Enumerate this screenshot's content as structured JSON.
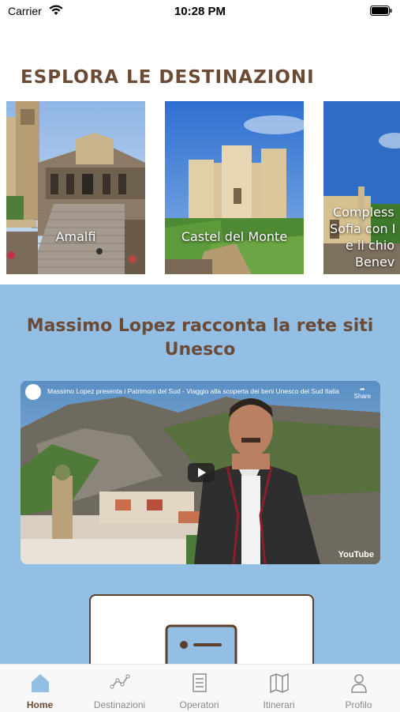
{
  "status_bar": {
    "carrier": "Carrier",
    "time": "10:28 PM"
  },
  "section_title": "ESPLORA LE DESTINAZIONI",
  "destinations": [
    {
      "name": "Amalfi"
    },
    {
      "name": "Castel del Monte"
    },
    {
      "name": "Complesso di Santa Sofia con il campanile e il chiostro Benevento",
      "visible_lines": [
        "Compless",
        "Sofia con I",
        "e il chio",
        "Benev"
      ]
    }
  ],
  "video_section": {
    "title": "Massimo Lopez racconta la rete siti Unesco",
    "video_title": "Massimo Lopez presenta i Patrimoni del Sud - Viaggio alla scoperta dei beni Unesco del Sud Italia",
    "share_label": "Share",
    "brand": "YouTube"
  },
  "tabs": [
    {
      "label": "Home",
      "icon": "home-icon",
      "active": true
    },
    {
      "label": "Destinazioni",
      "icon": "graph-icon",
      "active": false
    },
    {
      "label": "Operatori",
      "icon": "list-icon",
      "active": false
    },
    {
      "label": "Itinerari",
      "icon": "map-icon",
      "active": false
    },
    {
      "label": "Profilo",
      "icon": "person-icon",
      "active": false
    }
  ],
  "colors": {
    "accent": "#6b4b36",
    "tab_active": "#94bfe4",
    "section_bg": "#94bfe4"
  }
}
